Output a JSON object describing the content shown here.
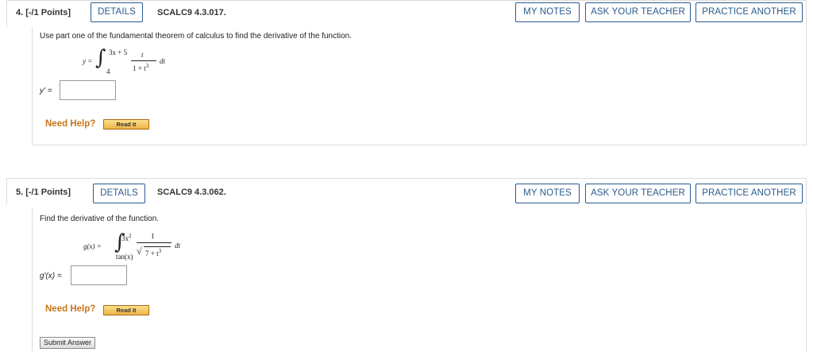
{
  "q1": {
    "number": "4. [-/1 Points]",
    "details": "DETAILS",
    "code": "SCALC9 4.3.017.",
    "my_notes": "MY NOTES",
    "ask_teacher": "ASK YOUR TEACHER",
    "practice_another": "PRACTICE ANOTHER",
    "prompt": "Use part one of the fundamental theorem of calculus to find the derivative of the function.",
    "lhs": "y =",
    "upper": "3x + 5",
    "lower": "4",
    "numerator": "t",
    "denominator": "1 + t",
    "exp": "3",
    "dt": "dt",
    "answer_label": "y' =",
    "need_help": "Need Help?",
    "read_it": "Read It"
  },
  "q2": {
    "number": "5. [-/1 Points]",
    "details": "DETAILS",
    "code": "SCALC9 4.3.062.",
    "my_notes": "MY NOTES",
    "ask_teacher": "ASK YOUR TEACHER",
    "practice_another": "PRACTICE ANOTHER",
    "prompt": "Find the derivative of the function.",
    "lhs": "g(x) =",
    "upper": "3x",
    "upper_exp": "2",
    "lower": "tan(x)",
    "numerator": "1",
    "denominator": "7 + t",
    "exp": "3",
    "dt": "dt",
    "answer_label": "g'(x) =",
    "need_help": "Need Help?",
    "read_it": "Read It",
    "submit": "Submit Answer"
  }
}
